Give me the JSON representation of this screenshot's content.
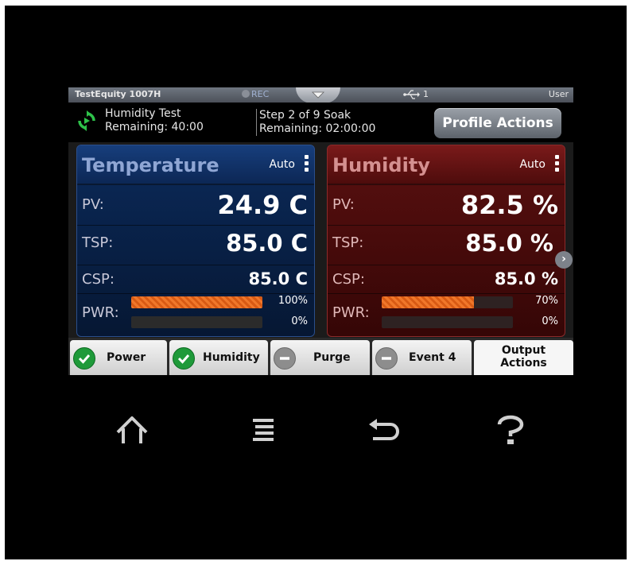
{
  "status_bar": {
    "device_title": "TestEquity 1007H",
    "rec_label": "REC",
    "usb_count": "1",
    "user_label": "User"
  },
  "profile": {
    "name": "Humidity Test",
    "remaining": "Remaining: 40:00",
    "step": "Step 2 of 9 Soak",
    "step_remaining": "Remaining: 02:00:00",
    "actions_button": "Profile Actions"
  },
  "temperature": {
    "title": "Temperature",
    "mode": "Auto",
    "pv_label": "PV:",
    "pv_value": "24.9 C",
    "tsp_label": "TSP:",
    "tsp_value": "85.0 C",
    "csp_label": "CSP:",
    "csp_value": "85.0 C",
    "pwr_label": "PWR:",
    "pwr_heat_pct": "100%",
    "pwr_heat_level": 1.0,
    "pwr_cool_pct": "0%",
    "pwr_cool_level": 0.0
  },
  "humidity": {
    "title": "Humidity",
    "mode": "Auto",
    "pv_label": "PV:",
    "pv_value": "82.5 %",
    "tsp_label": "TSP:",
    "tsp_value": "85.0 %",
    "csp_label": "CSP:",
    "csp_value": "85.0 %",
    "pwr_label": "PWR:",
    "pwr_humid_pct": "70%",
    "pwr_humid_level": 0.7,
    "pwr_dehumid_pct": "0%",
    "pwr_dehumid_level": 0.0
  },
  "outputs": {
    "items": [
      {
        "label": "Power",
        "state": "on"
      },
      {
        "label": "Humidity",
        "state": "on"
      },
      {
        "label": "Purge",
        "state": "off"
      },
      {
        "label": "Event 4",
        "state": "off"
      }
    ],
    "actions_line1": "Output",
    "actions_line2": "Actions"
  },
  "nav_keys": [
    "home-icon",
    "menu-icon",
    "back-icon",
    "help-icon"
  ],
  "colors": {
    "temperature_panel": "#0b2a5a",
    "humidity_panel": "#5a1010",
    "power_bar": "#f0772a",
    "output_on": "#1f9a3a",
    "output_off": "#8d8d8d"
  }
}
